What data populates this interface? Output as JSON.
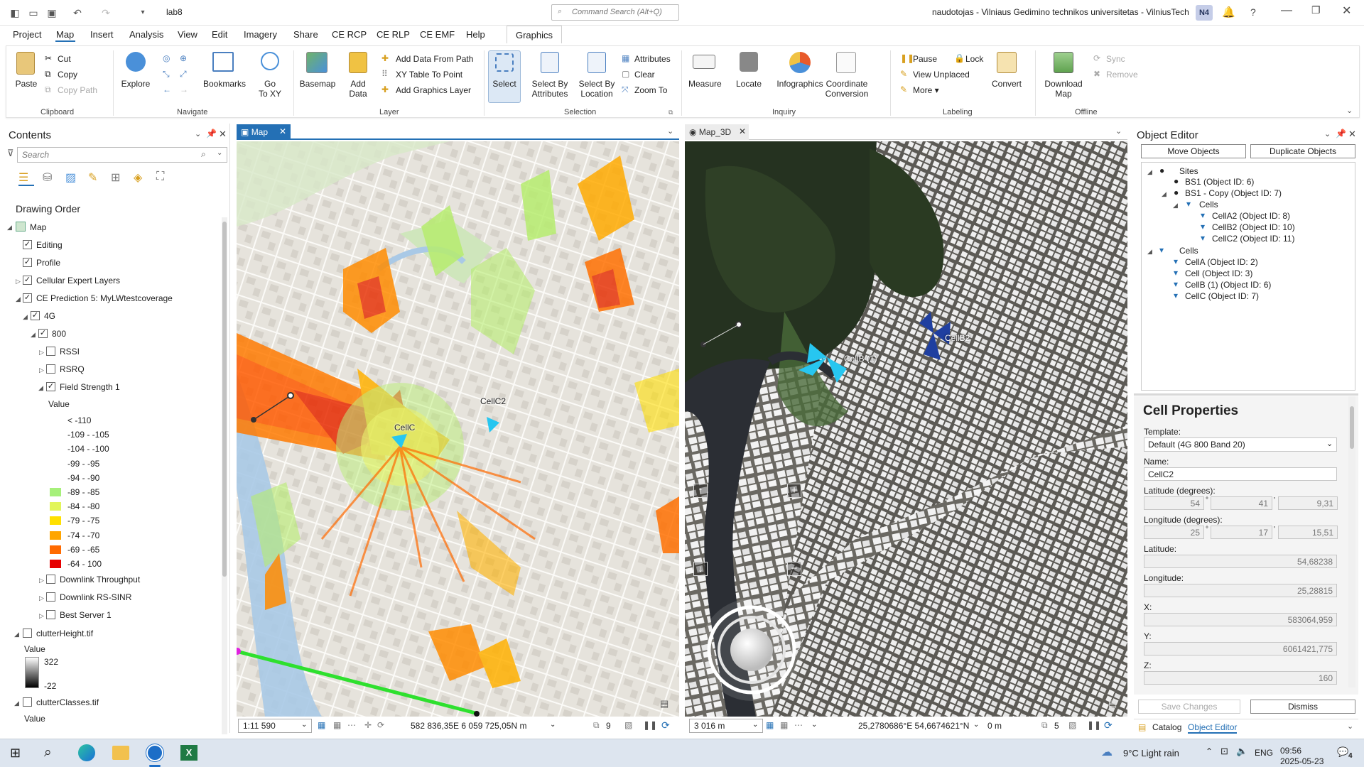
{
  "titlebar": {
    "project": "lab8",
    "command_search_placeholder": "Command Search (Alt+Q)",
    "user": "naudotojas - Vilniaus Gedimino technikos universitetas - VilniusTech",
    "user_initials": "N4"
  },
  "menu": [
    "Project",
    "Map",
    "Insert",
    "Analysis",
    "View",
    "Edit",
    "Imagery",
    "Share",
    "CE RCP",
    "CE RLP",
    "CE EMF",
    "Help"
  ],
  "contextual_tab": "Graphics",
  "ribbon": {
    "clipboard": {
      "paste": "Paste",
      "cut": "Cut",
      "copy": "Copy",
      "copy_path": "Copy Path",
      "label": "Clipboard"
    },
    "navigate": {
      "explore": "Explore",
      "bookmarks": "Bookmarks",
      "goto1": "Go",
      "goto2": "To XY",
      "label": "Navigate"
    },
    "layer": {
      "basemap": "Basemap",
      "add1": "Add",
      "add2": "Data",
      "add_data_path": "Add Data From Path",
      "xy_point": "XY Table To Point",
      "add_graphics": "Add Graphics Layer",
      "label": "Layer"
    },
    "selection": {
      "select": "Select",
      "sba1": "Select By",
      "sba2": "Attributes",
      "sbl1": "Select By",
      "sbl2": "Location",
      "attributes": "Attributes",
      "clear": "Clear",
      "zoom_to": "Zoom To",
      "label": "Selection"
    },
    "inquiry": {
      "measure": "Measure",
      "locate": "Locate",
      "infographics": "Infographics",
      "coord1": "Coordinate",
      "coord2": "Conversion",
      "label": "Inquiry"
    },
    "labeling": {
      "pause": "Pause",
      "lock": "Lock",
      "view_unplaced": "View Unplaced",
      "more": "More",
      "convert": "Convert",
      "label": "Labeling"
    },
    "offline": {
      "download1": "Download",
      "download2": "Map",
      "sync": "Sync",
      "remove": "Remove",
      "label": "Offline"
    }
  },
  "contents": {
    "title": "Contents",
    "search_placeholder": "Search",
    "drawing_order": "Drawing Order",
    "tree": {
      "map": "Map",
      "editing": "Editing",
      "profile": "Profile",
      "cellular": "Cellular Expert Layers",
      "prediction": "CE Prediction 5: MyLWtestcoverage",
      "g4": "4G",
      "b800": "800",
      "rssi": "RSSI",
      "rsrq": "RSRQ",
      "field_strength": "Field Strength 1",
      "value": "Value",
      "downlink_tp": "Downlink Throughput",
      "downlink_sinr": "Downlink RS-SINR",
      "best_server": "Best Server 1",
      "clutter_height": "clutterHeight.tif",
      "value2": "Value",
      "ch_max": "322",
      "ch_min": "-22",
      "clutter_classes": "clutterClasses.tif",
      "value3": "Value"
    },
    "legend": [
      {
        "label": "< -110",
        "color": ""
      },
      {
        "label": "-109 - -105",
        "color": ""
      },
      {
        "label": "-104 - -100",
        "color": ""
      },
      {
        "label": "-99 - -95",
        "color": ""
      },
      {
        "label": "-94 - -90",
        "color": ""
      },
      {
        "label": "-89 - -85",
        "color": "#a6f07a"
      },
      {
        "label": "-84 - -80",
        "color": "#e2f55a"
      },
      {
        "label": "-79 - -75",
        "color": "#ffe000"
      },
      {
        "label": "-74 - -70",
        "color": "#ffa500"
      },
      {
        "label": "-69 - -65",
        "color": "#ff6a00"
      },
      {
        "label": "-64 - 100",
        "color": "#e60000"
      }
    ]
  },
  "map2d": {
    "tab": "Map",
    "labels": {
      "cellc": "CellC",
      "cellc2": "CellC2"
    },
    "scale": "1:11 590",
    "coords": "582 836,35E 6 059 725,05N m",
    "selected_count": "9"
  },
  "map3d": {
    "tab": "Map_3D",
    "labels": {
      "cellb": "CellB (1)",
      "cellb2": "CellB2"
    },
    "scale": "3 016 m",
    "coords": "25,2780686°E 54,6674621°N",
    "elev": "0 m",
    "selected_count": "5"
  },
  "object_editor": {
    "title": "Object Editor",
    "move": "Move Objects",
    "duplicate": "Duplicate Objects",
    "tree": {
      "sites": "Sites",
      "bs1": "BS1 (Object ID: 6)",
      "bs1copy": "BS1 - Copy (Object ID: 7)",
      "cells1": "Cells",
      "cella2": "CellA2 (Object ID: 8)",
      "cellb2": "CellB2 (Object ID: 10)",
      "cellc2": "CellC2 (Object ID: 11)",
      "cells2": "Cells",
      "cella": "CellA (Object ID: 2)",
      "cell": "Cell (Object ID: 3)",
      "cellb1": "CellB (1) (Object ID: 6)",
      "cellc": "CellC (Object ID: 7)"
    },
    "props": {
      "heading": "Cell Properties",
      "template_label": "Template:",
      "template": "Default (4G 800 Band 20)",
      "name_label": "Name:",
      "name": "CellC2",
      "lat_deg_label": "Latitude (degrees):",
      "lat_d": "54",
      "lat_m": "41",
      "lat_s": "9,31",
      "lon_deg_label": "Longitude (degrees):",
      "lon_d": "25",
      "lon_m": "17",
      "lon_s": "15,51",
      "lat_label": "Latitude:",
      "lat": "54,68238",
      "lon_label": "Longitude:",
      "lon": "25,28815",
      "x_label": "X:",
      "x": "583064,959",
      "y_label": "Y:",
      "y": "6061421,775",
      "z_label": "Z:",
      "z": "160"
    },
    "save": "Save Changes",
    "dismiss": "Dismiss",
    "tab_catalog": "Catalog",
    "tab_oe": "Object Editor"
  },
  "taskbar": {
    "weather": "9°C  Light rain",
    "lang": "ENG",
    "time": "09:56",
    "date": "2025-05-23",
    "notif": "4"
  }
}
